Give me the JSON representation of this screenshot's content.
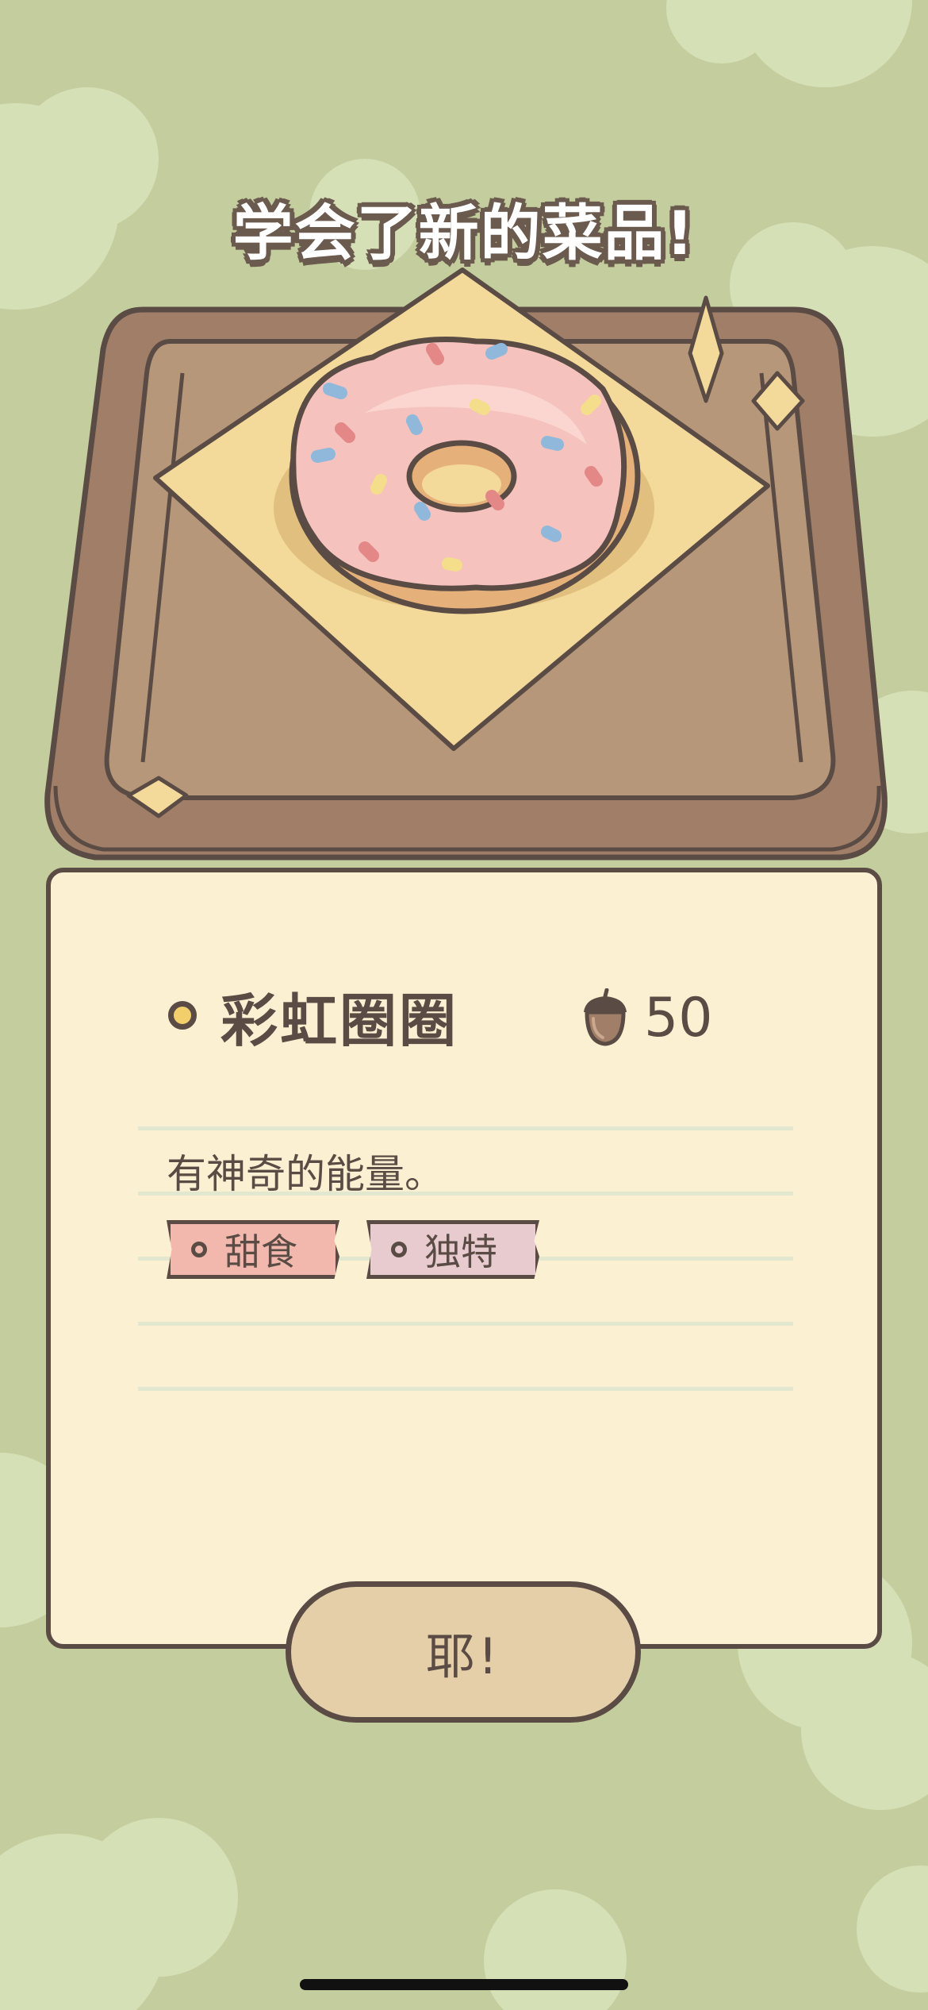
{
  "title": "学会了新的菜品!",
  "dish": {
    "name": "彩虹圈圈",
    "price": "50",
    "price_icon": "acorn-icon",
    "description": "有神奇的能量。",
    "tags": [
      {
        "label": "甜食",
        "color": "#f2b8ae"
      },
      {
        "label": "独特",
        "color": "#e7cbcf"
      }
    ]
  },
  "confirm_button": "耶!",
  "colors": {
    "background": "#c4cd9d",
    "card": "#fbf0d2",
    "button": "#e4cfa8",
    "outline": "#5b4b45",
    "tray": "#a07e67",
    "napkin": "#f3d99a",
    "frosting": "#f5c2bd"
  }
}
